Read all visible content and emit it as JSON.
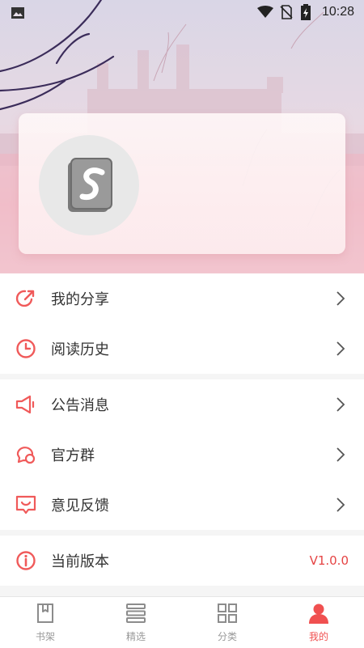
{
  "status_bar": {
    "time": "10:28"
  },
  "menu_group_1": [
    {
      "label": "我的分享",
      "icon": "share-icon"
    },
    {
      "label": "阅读历史",
      "icon": "clock-icon"
    }
  ],
  "menu_group_2": [
    {
      "label": "公告消息",
      "icon": "megaphone-icon"
    },
    {
      "label": "官方群",
      "icon": "chat-bubbles-icon"
    },
    {
      "label": "意见反馈",
      "icon": "feedback-icon"
    }
  ],
  "menu_group_3": [
    {
      "label": "当前版本",
      "icon": "info-icon",
      "value": "V1.0.0"
    }
  ],
  "tabs": [
    {
      "label": "书架",
      "icon": "bookshelf-icon",
      "active": false
    },
    {
      "label": "精选",
      "icon": "stack-icon",
      "active": false
    },
    {
      "label": "分类",
      "icon": "grid-icon",
      "active": false
    },
    {
      "label": "我的",
      "icon": "person-icon",
      "active": true
    }
  ],
  "colors": {
    "accent": "#f05050",
    "version_text": "#e54444",
    "icon_red": "#f05a5a"
  }
}
